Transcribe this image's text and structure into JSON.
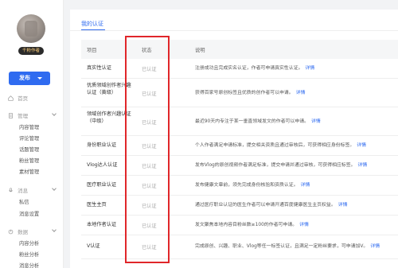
{
  "sidebar": {
    "level_badge": "千粉作者",
    "publish_label": "发布",
    "home_label": "首页",
    "groups": [
      {
        "label": "管理",
        "items": [
          "内容管理",
          "评论管理",
          "话题管理",
          "粉丝管理",
          "素材管理"
        ]
      },
      {
        "label": "消息",
        "items": [
          "私信",
          "消息设置"
        ]
      },
      {
        "label": "数据",
        "items": [
          "内容分析",
          "粉丝分析",
          "消息分析"
        ]
      }
    ]
  },
  "main": {
    "tab_label": "我的认证",
    "columns": {
      "item": "项目",
      "status": "状态",
      "desc": "说明"
    },
    "detail_link": "详情",
    "rows": [
      {
        "name": "真实性认证",
        "status": "已认证",
        "desc": "注册成功且完成实名认证，作者可申请真实性认证。"
      },
      {
        "name": "优质领域创作者兴趣认证（黄级）",
        "status": "已认证",
        "desc": "获得百家号原创标签且优质的创作者可以申请。"
      },
      {
        "name": "领域创作者兴趣认证（中级）",
        "status": "已认证",
        "desc": "最近90天内专注于某一垂直领域发文的作者可以申请。"
      },
      {
        "name": "身份职业认证",
        "status": "已认证",
        "desc": "个人作者满足申请标准，提交相关资质且通过审核后，可获得相应身份标签。"
      },
      {
        "name": "Vlog达人认证",
        "status": "已认证",
        "desc": "发布Vlog的原创视频作者满足标准，提交申请并通过审核，可获得相应标签。"
      },
      {
        "name": "医疗职业认证",
        "status": "已认证",
        "desc": "发布健康文章前，须先完成身份核验和资质认证。"
      },
      {
        "name": "医生主页",
        "status": "已认证",
        "desc": "通过医疗职业认证的医生作者可以申请开通百度健康医生主页权益。"
      },
      {
        "name": "本地作者认证",
        "status": "已认证",
        "desc": "发文聚焦本地内容目粉丝数≥100的作者可申请。"
      },
      {
        "name": "V认证",
        "status": "已认证",
        "desc": "完成原创、兴趣、职业、Vlog等任一标签认证，且满足一定粉丝要求，可申请加V。"
      }
    ]
  },
  "colors": {
    "accent": "#2f6bf0",
    "highlight": "#e0262a",
    "status_text": "#aaaaaa"
  }
}
